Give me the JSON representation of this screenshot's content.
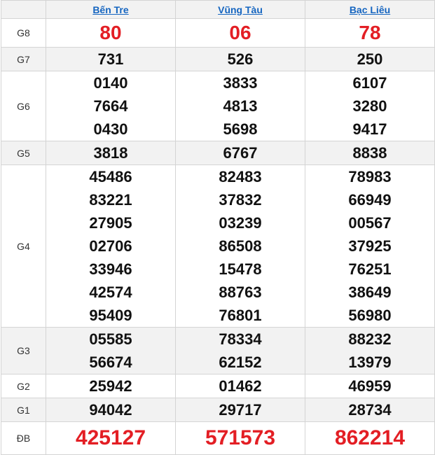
{
  "provinces": [
    "Bến Tre",
    "Vũng Tàu",
    "Bạc Liêu"
  ],
  "accent_color": "#e31e24",
  "link_color": "#1565c0",
  "prizes": [
    {
      "label": "G8",
      "results": [
        [
          "80"
        ],
        [
          "06"
        ],
        [
          "78"
        ]
      ]
    },
    {
      "label": "G7",
      "results": [
        [
          "731"
        ],
        [
          "526"
        ],
        [
          "250"
        ]
      ]
    },
    {
      "label": "G6",
      "results": [
        [
          "0140",
          "7664",
          "0430"
        ],
        [
          "3833",
          "4813",
          "5698"
        ],
        [
          "6107",
          "3280",
          "9417"
        ]
      ]
    },
    {
      "label": "G5",
      "results": [
        [
          "3818"
        ],
        [
          "6767"
        ],
        [
          "8838"
        ]
      ]
    },
    {
      "label": "G4",
      "results": [
        [
          "45486",
          "83221",
          "27905",
          "02706",
          "33946",
          "42574",
          "95409"
        ],
        [
          "82483",
          "37832",
          "03239",
          "86508",
          "15478",
          "88763",
          "76801"
        ],
        [
          "78983",
          "66949",
          "00567",
          "37925",
          "76251",
          "38649",
          "56980"
        ]
      ]
    },
    {
      "label": "G3",
      "results": [
        [
          "05585",
          "56674"
        ],
        [
          "78334",
          "62152"
        ],
        [
          "88232",
          "13979"
        ]
      ]
    },
    {
      "label": "G2",
      "results": [
        [
          "25942"
        ],
        [
          "01462"
        ],
        [
          "46959"
        ]
      ]
    },
    {
      "label": "G1",
      "results": [
        [
          "94042"
        ],
        [
          "29717"
        ],
        [
          "28734"
        ]
      ]
    },
    {
      "label": "ĐB",
      "results": [
        [
          "425127"
        ],
        [
          "571573"
        ],
        [
          "862214"
        ]
      ]
    }
  ]
}
